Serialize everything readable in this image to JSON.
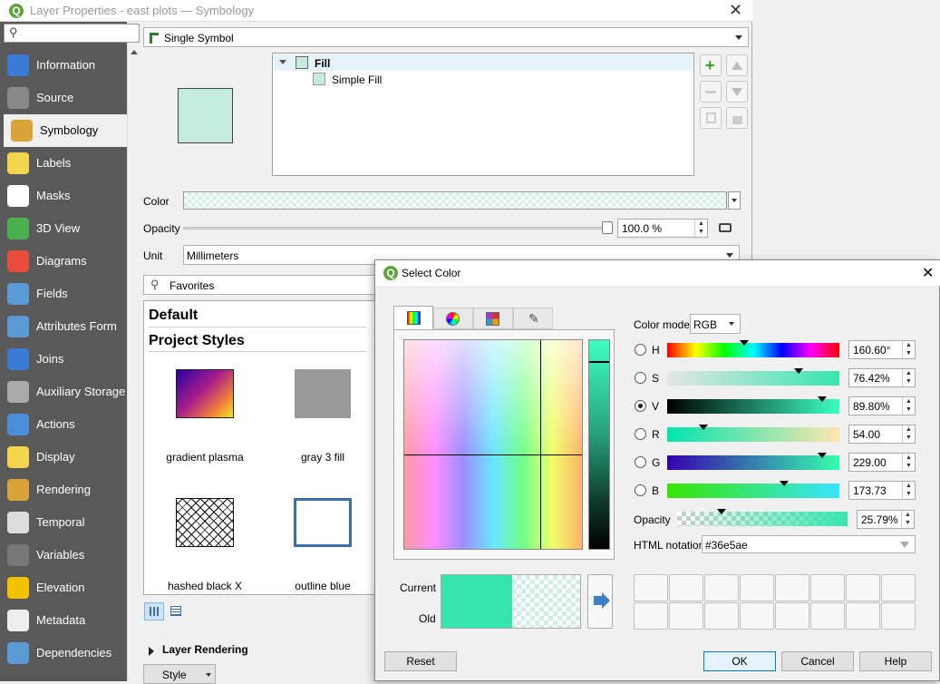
{
  "window": {
    "title": "Layer Properties - east plots — Symbology"
  },
  "sidebar": {
    "items": [
      {
        "label": "Information",
        "color": "#3a7bd5"
      },
      {
        "label": "Source",
        "color": "#888888"
      },
      {
        "label": "Symbology",
        "color": "#d9a33a"
      },
      {
        "label": "Labels",
        "color": "#f2d54a"
      },
      {
        "label": "Masks",
        "color": "#ffffff"
      },
      {
        "label": "3D View",
        "color": "#4caf50"
      },
      {
        "label": "Diagrams",
        "color": "#e74c3c"
      },
      {
        "label": "Fields",
        "color": "#5b9bd5"
      },
      {
        "label": "Attributes Form",
        "color": "#5b9bd5"
      },
      {
        "label": "Joins",
        "color": "#3a7bd5"
      },
      {
        "label": "Auxiliary Storage",
        "color": "#aaaaaa"
      },
      {
        "label": "Actions",
        "color": "#4a90d9"
      },
      {
        "label": "Display",
        "color": "#f2d54a"
      },
      {
        "label": "Rendering",
        "color": "#d9a33a"
      },
      {
        "label": "Temporal",
        "color": "#dddddd"
      },
      {
        "label": "Variables",
        "color": "#777777"
      },
      {
        "label": "Elevation",
        "color": "#f2c200"
      },
      {
        "label": "Metadata",
        "color": "#eeeeee"
      },
      {
        "label": "Dependencies",
        "color": "#5b9bd5"
      }
    ],
    "selected_index": 2
  },
  "symbology": {
    "renderer": "Single Symbol",
    "tree": {
      "root": "Fill",
      "child": "Simple Fill"
    },
    "fill_color": "#c3ecdf",
    "color_label": "Color",
    "opacity_label": "Opacity",
    "opacity_value": "100.0 %",
    "unit_label": "Unit",
    "unit_value": "Millimeters",
    "search_placeholder": "Favorites",
    "groups": [
      "Default",
      "Project Styles"
    ],
    "styles": [
      {
        "label": "gradient   plasma"
      },
      {
        "label": "gray 3 fill"
      },
      {
        "label": "hashed black X"
      },
      {
        "label": "outline blue"
      }
    ],
    "layer_rendering": "Layer Rendering",
    "style_button": "Style"
  },
  "dialog": {
    "title": "Select Color",
    "color_model_label": "Color model",
    "color_model": "RGB",
    "channels": [
      {
        "label": "H",
        "value": "160.60°",
        "fraction": 0.446,
        "checked": false
      },
      {
        "label": "S",
        "value": "76.42%",
        "fraction": 0.764,
        "checked": false
      },
      {
        "label": "V",
        "value": "89.80%",
        "fraction": 0.898,
        "checked": true
      },
      {
        "label": "R",
        "value": "54.00",
        "fraction": 0.212,
        "checked": false
      },
      {
        "label": "G",
        "value": "229.00",
        "fraction": 0.898,
        "checked": false
      },
      {
        "label": "B",
        "value": "173.73",
        "fraction": 0.681,
        "checked": false
      }
    ],
    "opacity_label": "Opacity",
    "opacity_value": "25.79%",
    "opacity_fraction": 0.258,
    "html_label": "HTML notation",
    "html_value": "#36e5ae",
    "current_label": "Current",
    "old_label": "Old",
    "current_color": "#36e5ae",
    "buttons": {
      "reset": "Reset",
      "ok": "OK",
      "cancel": "Cancel",
      "help": "Help"
    }
  }
}
